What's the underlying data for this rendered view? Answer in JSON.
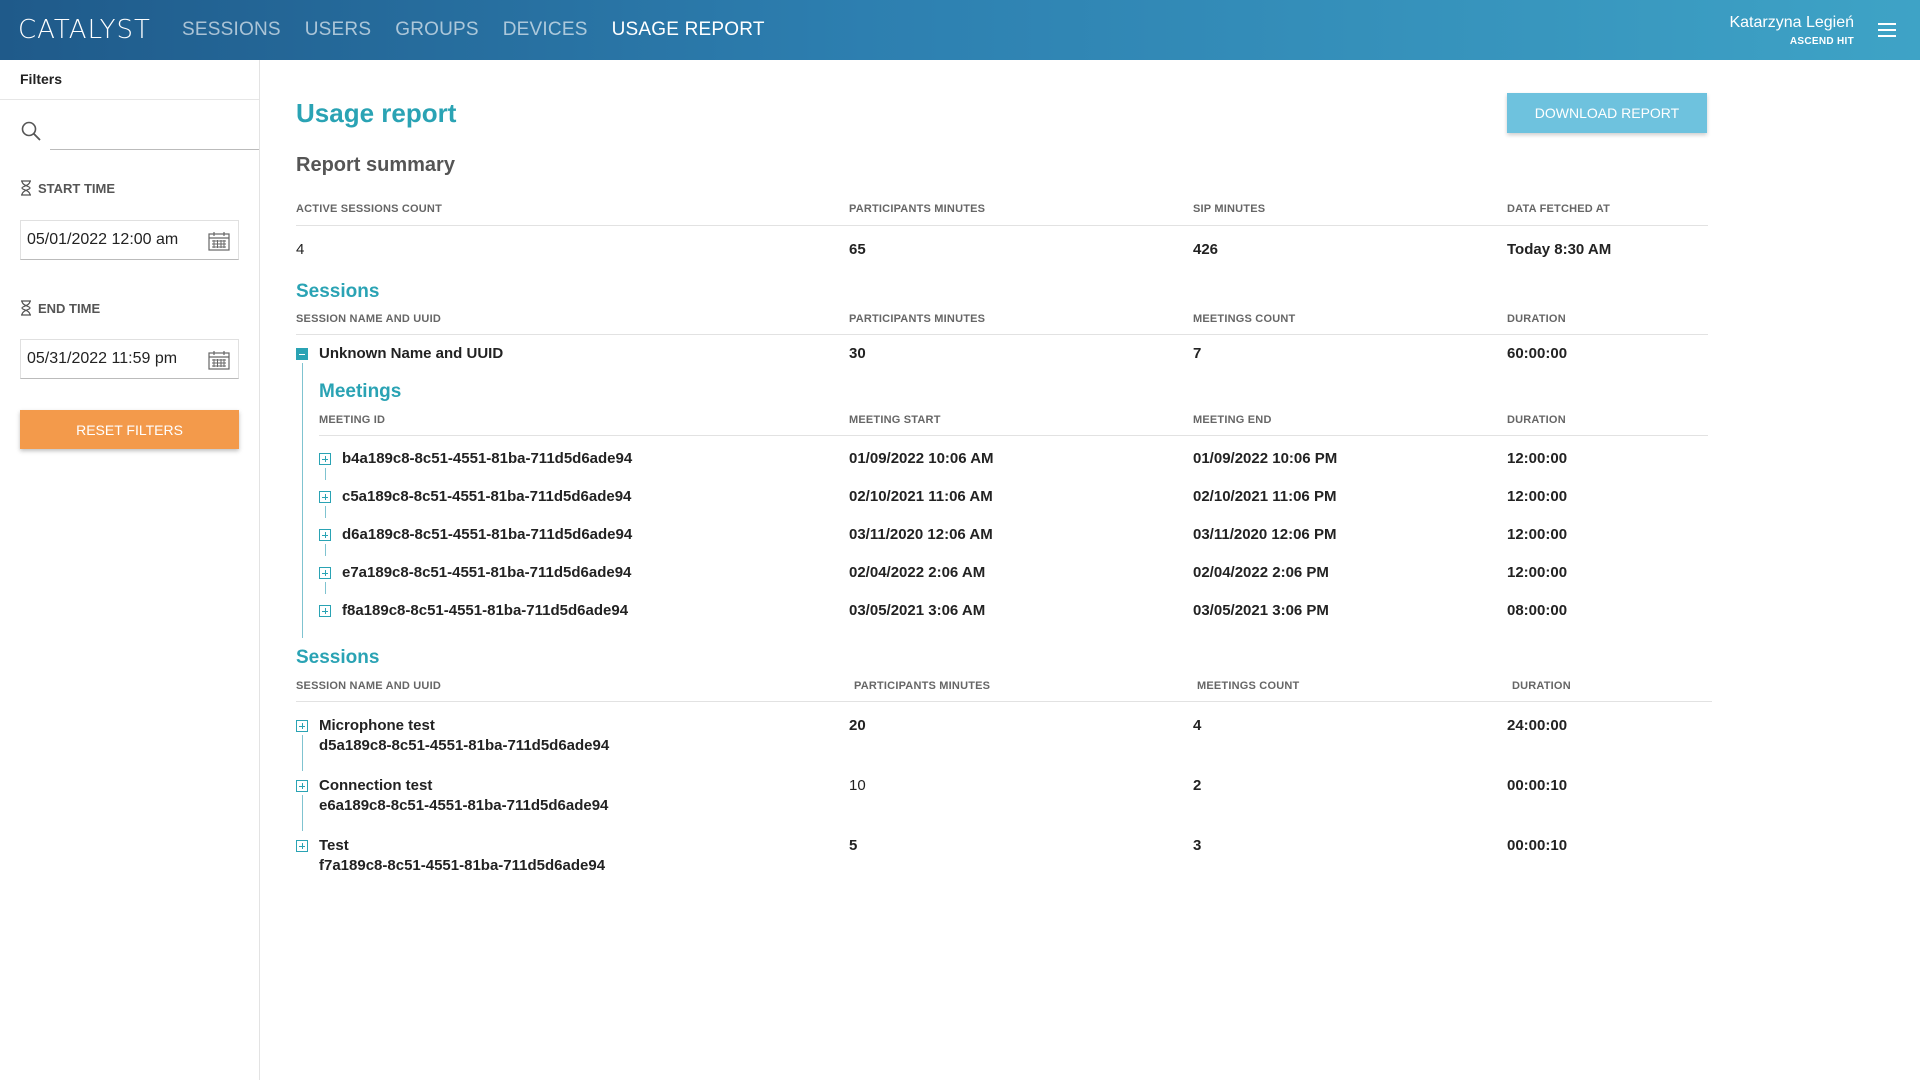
{
  "header": {
    "logo": "CATALYST",
    "nav": [
      {
        "label": "SESSIONS"
      },
      {
        "label": "USERS"
      },
      {
        "label": "GROUPS"
      },
      {
        "label": "DEVICES"
      },
      {
        "label": "USAGE REPORT"
      }
    ],
    "user_name": "Katarzyna Legień",
    "user_org": "ASCEND HIT"
  },
  "sidebar": {
    "title": "Filters",
    "search_value": "",
    "start_label": "START TIME",
    "start_value": "05/01/2022 12:00 am",
    "end_label": "END TIME",
    "end_value": "05/31/2022 11:59 pm",
    "reset_label": "RESET FILTERS"
  },
  "main": {
    "title": "Usage report",
    "download_label": "DOWNLOAD REPORT",
    "summary_title": "Report summary",
    "summary_headers": [
      "ACTIVE SESSIONS COUNT",
      "PARTICIPANTS MINUTES",
      "SIP MINUTES",
      "DATA FETCHED AT"
    ],
    "summary_values": [
      "4",
      "65",
      "426",
      "Today 8:30 AM"
    ],
    "sessions_title": "Sessions",
    "session_headers": [
      "SESSION NAME AND UUID",
      "PARTICIPANTS MINUTES",
      "MEETINGS COUNT",
      "DURATION"
    ],
    "expanded_session": {
      "name": "Unknown Name and UUID",
      "minutes": "30",
      "count": "7",
      "duration": "60:00:00"
    },
    "meetings_title": "Meetings",
    "meeting_headers": [
      "MEETING ID",
      "MEETING START",
      "MEETING END",
      "DURATION"
    ],
    "meetings": [
      {
        "id": "b4a189c8-8c51-4551-81ba-711d5d6ade94",
        "start": "01/09/2022 10:06 AM",
        "end": "01/09/2022 10:06 PM",
        "duration": "12:00:00"
      },
      {
        "id": "c5a189c8-8c51-4551-81ba-711d5d6ade94",
        "start": "02/10/2021 11:06 AM",
        "end": "02/10/2021 11:06 PM",
        "duration": "12:00:00"
      },
      {
        "id": "d6a189c8-8c51-4551-81ba-711d5d6ade94",
        "start": "03/11/2020 12:06 AM",
        "end": "03/11/2020 12:06 PM",
        "duration": "12:00:00"
      },
      {
        "id": "e7a189c8-8c51-4551-81ba-711d5d6ade94",
        "start": "02/04/2022 2:06 AM",
        "end": "02/04/2022 2:06 PM",
        "duration": "12:00:00"
      },
      {
        "id": "f8a189c8-8c51-4551-81ba-711d5d6ade94",
        "start": "03/05/2021 3:06 AM",
        "end": "03/05/2021 3:06 PM",
        "duration": "08:00:00"
      }
    ],
    "sessions2_title": "Sessions",
    "sessions2": [
      {
        "name": "Microphone test",
        "uuid": "d5a189c8-8c51-4551-81ba-711d5d6ade94",
        "minutes": "20",
        "count": "4",
        "duration": "24:00:00"
      },
      {
        "name": "Connection test",
        "uuid": "e6a189c8-8c51-4551-81ba-711d5d6ade94",
        "minutes": "10",
        "count": "2",
        "duration": "00:00:10"
      },
      {
        "name": "Test",
        "uuid": "f7a189c8-8c51-4551-81ba-711d5d6ade94",
        "minutes": "5",
        "count": "3",
        "duration": "00:00:10"
      }
    ]
  },
  "colors": {
    "accent": "#2aa3b4",
    "reset": "#f39a4b",
    "download": "#6ec2de"
  },
  "icons": {
    "search": "search-icon",
    "hourglass": "hourglass-icon",
    "calendar": "calendar-icon",
    "menu": "hamburger-menu-icon",
    "expand": "plus-box-icon",
    "collapse": "minus-box-icon"
  }
}
